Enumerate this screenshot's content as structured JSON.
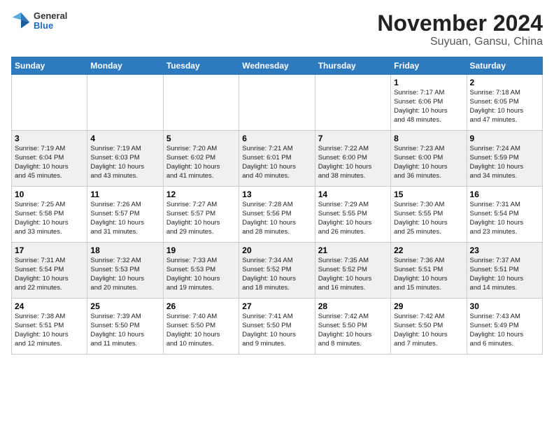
{
  "header": {
    "logo_general": "General",
    "logo_blue": "Blue",
    "title": "November 2024",
    "subtitle": "Suyuan, Gansu, China"
  },
  "weekdays": [
    "Sunday",
    "Monday",
    "Tuesday",
    "Wednesday",
    "Thursday",
    "Friday",
    "Saturday"
  ],
  "weeks": [
    [
      {
        "day": "",
        "info": ""
      },
      {
        "day": "",
        "info": ""
      },
      {
        "day": "",
        "info": ""
      },
      {
        "day": "",
        "info": ""
      },
      {
        "day": "",
        "info": ""
      },
      {
        "day": "1",
        "info": "Sunrise: 7:17 AM\nSunset: 6:06 PM\nDaylight: 10 hours\nand 48 minutes."
      },
      {
        "day": "2",
        "info": "Sunrise: 7:18 AM\nSunset: 6:05 PM\nDaylight: 10 hours\nand 47 minutes."
      }
    ],
    [
      {
        "day": "3",
        "info": "Sunrise: 7:19 AM\nSunset: 6:04 PM\nDaylight: 10 hours\nand 45 minutes."
      },
      {
        "day": "4",
        "info": "Sunrise: 7:19 AM\nSunset: 6:03 PM\nDaylight: 10 hours\nand 43 minutes."
      },
      {
        "day": "5",
        "info": "Sunrise: 7:20 AM\nSunset: 6:02 PM\nDaylight: 10 hours\nand 41 minutes."
      },
      {
        "day": "6",
        "info": "Sunrise: 7:21 AM\nSunset: 6:01 PM\nDaylight: 10 hours\nand 40 minutes."
      },
      {
        "day": "7",
        "info": "Sunrise: 7:22 AM\nSunset: 6:00 PM\nDaylight: 10 hours\nand 38 minutes."
      },
      {
        "day": "8",
        "info": "Sunrise: 7:23 AM\nSunset: 6:00 PM\nDaylight: 10 hours\nand 36 minutes."
      },
      {
        "day": "9",
        "info": "Sunrise: 7:24 AM\nSunset: 5:59 PM\nDaylight: 10 hours\nand 34 minutes."
      }
    ],
    [
      {
        "day": "10",
        "info": "Sunrise: 7:25 AM\nSunset: 5:58 PM\nDaylight: 10 hours\nand 33 minutes."
      },
      {
        "day": "11",
        "info": "Sunrise: 7:26 AM\nSunset: 5:57 PM\nDaylight: 10 hours\nand 31 minutes."
      },
      {
        "day": "12",
        "info": "Sunrise: 7:27 AM\nSunset: 5:57 PM\nDaylight: 10 hours\nand 29 minutes."
      },
      {
        "day": "13",
        "info": "Sunrise: 7:28 AM\nSunset: 5:56 PM\nDaylight: 10 hours\nand 28 minutes."
      },
      {
        "day": "14",
        "info": "Sunrise: 7:29 AM\nSunset: 5:55 PM\nDaylight: 10 hours\nand 26 minutes."
      },
      {
        "day": "15",
        "info": "Sunrise: 7:30 AM\nSunset: 5:55 PM\nDaylight: 10 hours\nand 25 minutes."
      },
      {
        "day": "16",
        "info": "Sunrise: 7:31 AM\nSunset: 5:54 PM\nDaylight: 10 hours\nand 23 minutes."
      }
    ],
    [
      {
        "day": "17",
        "info": "Sunrise: 7:31 AM\nSunset: 5:54 PM\nDaylight: 10 hours\nand 22 minutes."
      },
      {
        "day": "18",
        "info": "Sunrise: 7:32 AM\nSunset: 5:53 PM\nDaylight: 10 hours\nand 20 minutes."
      },
      {
        "day": "19",
        "info": "Sunrise: 7:33 AM\nSunset: 5:53 PM\nDaylight: 10 hours\nand 19 minutes."
      },
      {
        "day": "20",
        "info": "Sunrise: 7:34 AM\nSunset: 5:52 PM\nDaylight: 10 hours\nand 18 minutes."
      },
      {
        "day": "21",
        "info": "Sunrise: 7:35 AM\nSunset: 5:52 PM\nDaylight: 10 hours\nand 16 minutes."
      },
      {
        "day": "22",
        "info": "Sunrise: 7:36 AM\nSunset: 5:51 PM\nDaylight: 10 hours\nand 15 minutes."
      },
      {
        "day": "23",
        "info": "Sunrise: 7:37 AM\nSunset: 5:51 PM\nDaylight: 10 hours\nand 14 minutes."
      }
    ],
    [
      {
        "day": "24",
        "info": "Sunrise: 7:38 AM\nSunset: 5:51 PM\nDaylight: 10 hours\nand 12 minutes."
      },
      {
        "day": "25",
        "info": "Sunrise: 7:39 AM\nSunset: 5:50 PM\nDaylight: 10 hours\nand 11 minutes."
      },
      {
        "day": "26",
        "info": "Sunrise: 7:40 AM\nSunset: 5:50 PM\nDaylight: 10 hours\nand 10 minutes."
      },
      {
        "day": "27",
        "info": "Sunrise: 7:41 AM\nSunset: 5:50 PM\nDaylight: 10 hours\nand 9 minutes."
      },
      {
        "day": "28",
        "info": "Sunrise: 7:42 AM\nSunset: 5:50 PM\nDaylight: 10 hours\nand 8 minutes."
      },
      {
        "day": "29",
        "info": "Sunrise: 7:42 AM\nSunset: 5:50 PM\nDaylight: 10 hours\nand 7 minutes."
      },
      {
        "day": "30",
        "info": "Sunrise: 7:43 AM\nSunset: 5:49 PM\nDaylight: 10 hours\nand 6 minutes."
      }
    ]
  ]
}
